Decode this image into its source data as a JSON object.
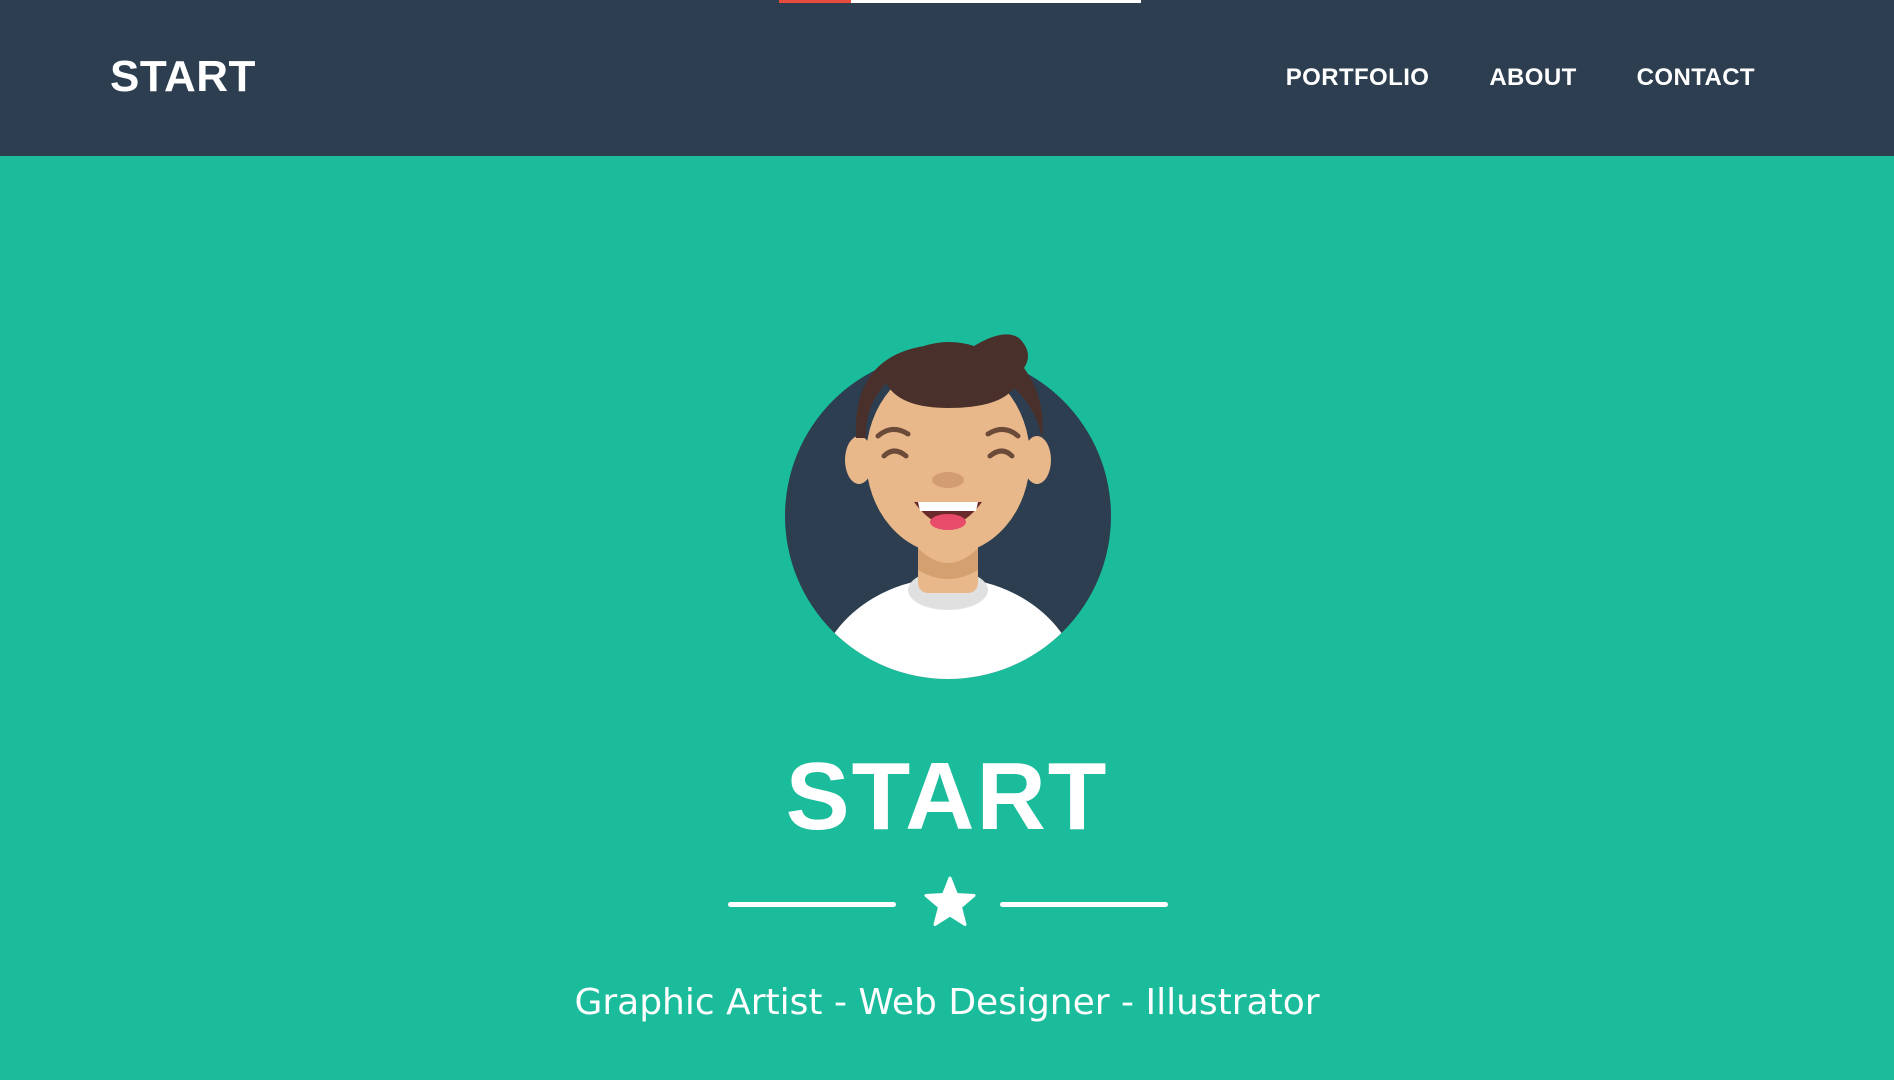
{
  "navbar": {
    "brand": "START",
    "items": [
      {
        "label": "PORTFOLIO"
      },
      {
        "label": "ABOUT"
      },
      {
        "label": "CONTACT"
      }
    ],
    "background": "#2c3e50"
  },
  "loading_bar": {
    "accent": "#e74c3c",
    "track": "#ffffff"
  },
  "hero": {
    "background": "#1abc9c",
    "avatar_icon": "avatar-profile-illustration",
    "title": "START",
    "divider_icon": "star-icon",
    "subtitle": "Graphic Artist - Web Designer - Illustrator"
  }
}
